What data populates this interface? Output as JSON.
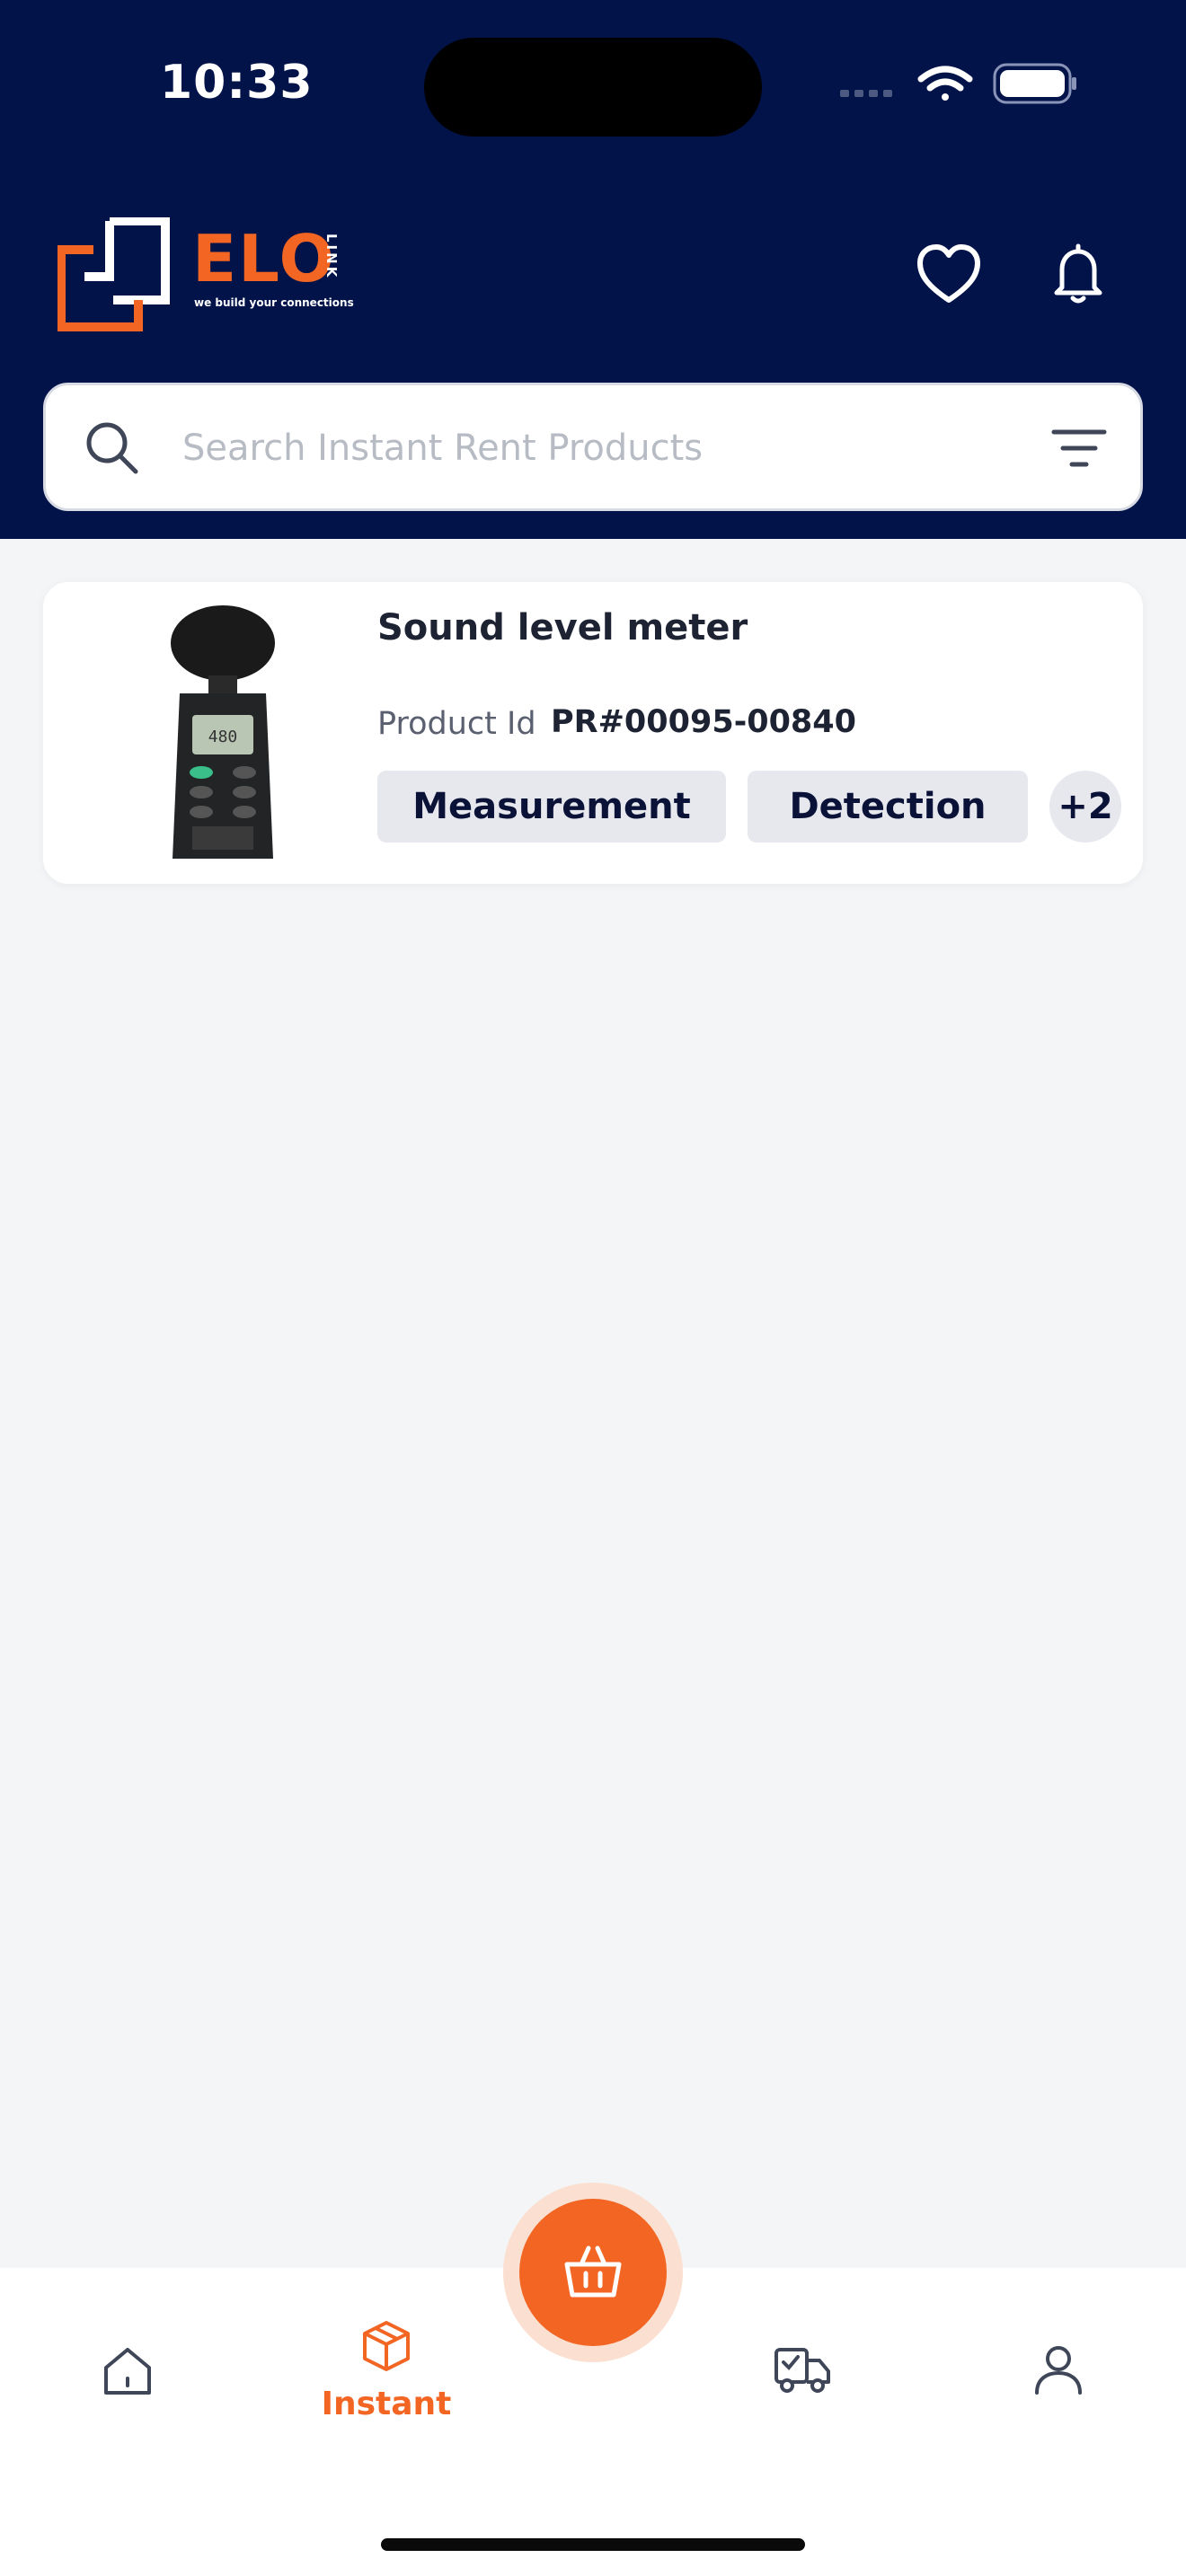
{
  "status_bar": {
    "time": "10:33",
    "icons": [
      "cellular-icon",
      "wifi-icon",
      "battery-icon"
    ]
  },
  "header": {
    "logo": {
      "name": "ELO",
      "suffix": "LINK",
      "tagline": "we build your connections"
    },
    "icons": [
      "heart-icon",
      "bell-icon"
    ]
  },
  "search": {
    "placeholder": "Search Instant Rent Products",
    "value": "",
    "icons": [
      "search-icon",
      "filter-icon"
    ]
  },
  "products": [
    {
      "name": "Sound level meter",
      "product_id_label": "Product Id",
      "product_id": "PR#00095-00840",
      "tags": [
        "Measurement",
        "Detection"
      ],
      "more_tags": "+2"
    }
  ],
  "bottom_nav": {
    "items": [
      {
        "icon": "home-icon",
        "label": ""
      },
      {
        "icon": "box-icon",
        "label": "Instant",
        "active": true
      },
      {
        "icon": "basket-icon",
        "label": ""
      },
      {
        "icon": "truck-icon",
        "label": ""
      },
      {
        "icon": "profile-icon",
        "label": ""
      }
    ]
  },
  "colors": {
    "header_bg": "#02134a",
    "accent": "#f26522",
    "page_bg": "#f4f5f7",
    "tag_bg": "#e6e8ee",
    "tag_text": "#0a1238"
  }
}
